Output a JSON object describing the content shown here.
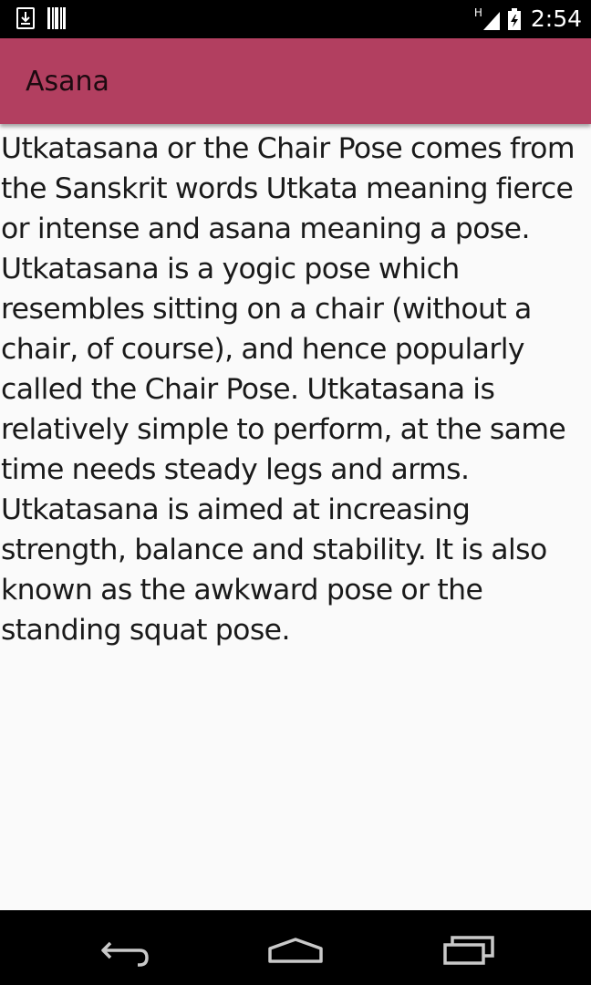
{
  "status_bar": {
    "time": "2:54",
    "network_type": "H",
    "icons": [
      "download-icon",
      "barcode-icon",
      "signal-icon",
      "battery-charging-icon"
    ]
  },
  "app_bar": {
    "title": "Asana",
    "color": "#b23f60"
  },
  "content": {
    "text": "Utkatasana or the Chair Pose comes from the Sanskrit words Utkata meaning fierce or intense and asana meaning a pose. Utkatasana is a yogic pose which resembles sitting on a chair (without a chair, of course), and hence popularly called the Chair Pose. Utkatasana is relatively simple to perform, at the same time needs steady legs and arms. Utkatasana is aimed at increasing strength, balance and stability. It is also known as the awkward pose or the standing squat pose."
  },
  "nav_bar": {
    "buttons": [
      "back-icon",
      "home-icon",
      "recents-icon"
    ]
  }
}
